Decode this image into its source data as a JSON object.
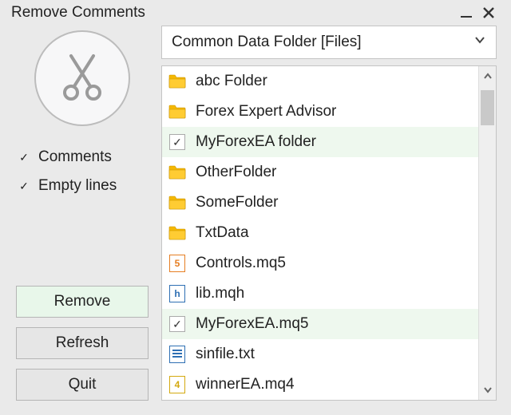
{
  "window": {
    "title": "Remove Comments"
  },
  "combo": {
    "value": "Common Data Folder [Files]"
  },
  "options": {
    "comments": {
      "label": "Comments",
      "checked": true
    },
    "emptylines": {
      "label": "Empty lines",
      "checked": true
    }
  },
  "buttons": {
    "remove": "Remove",
    "refresh": "Refresh",
    "quit": "Quit"
  },
  "list": {
    "items": [
      {
        "kind": "folder",
        "label": "abc Folder",
        "selected": false
      },
      {
        "kind": "folder",
        "label": "Forex Expert Advisor",
        "selected": false
      },
      {
        "kind": "checked",
        "label": "MyForexEA folder",
        "selected": true
      },
      {
        "kind": "folder",
        "label": "OtherFolder",
        "selected": false
      },
      {
        "kind": "folder",
        "label": "SomeFolder",
        "selected": false
      },
      {
        "kind": "folder",
        "label": "TxtData",
        "selected": false
      },
      {
        "kind": "mq5",
        "label": "Controls.mq5",
        "selected": false
      },
      {
        "kind": "mqh",
        "label": "lib.mqh",
        "selected": false
      },
      {
        "kind": "checked",
        "label": "MyForexEA.mq5",
        "selected": true
      },
      {
        "kind": "txt",
        "label": "sinfile.txt",
        "selected": false
      },
      {
        "kind": "mq4",
        "label": "winnerEA.mq4",
        "selected": false
      }
    ]
  }
}
